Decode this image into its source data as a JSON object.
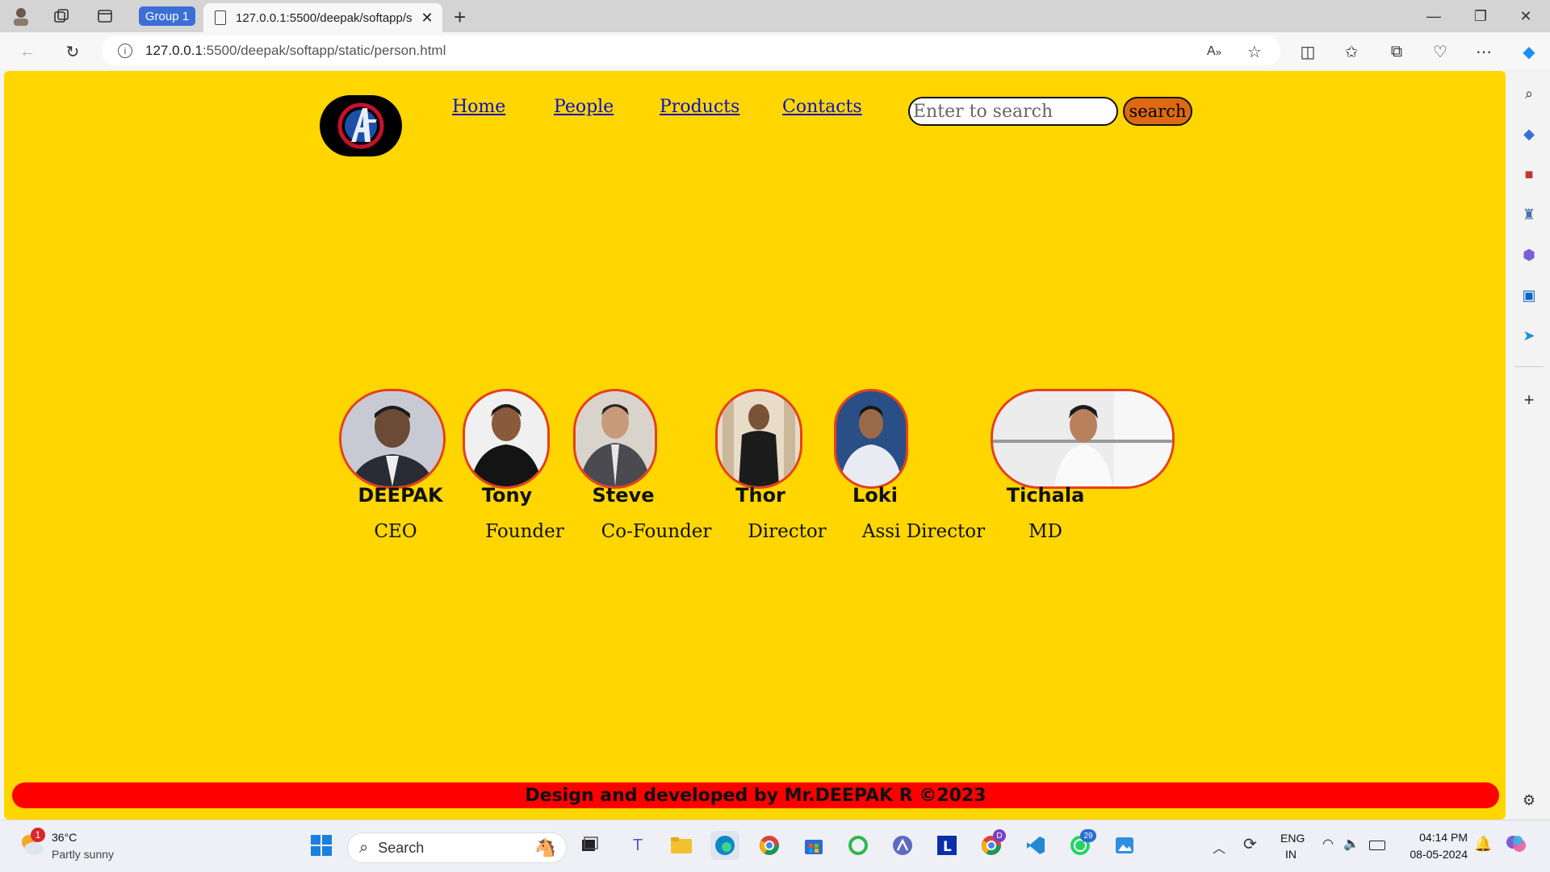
{
  "browser": {
    "group_label": "Group 1",
    "tab_title": "127.0.0.1:5500/deepak/softapp/s",
    "url_host": "127.0.0.1",
    "url_path": ":5500/deepak/softapp/static/person.html"
  },
  "site": {
    "nav": [
      "Home",
      "People",
      "Products",
      "Contacts"
    ],
    "search_placeholder": "Enter to search",
    "search_button": "search",
    "people": [
      {
        "name": "DEEPAK",
        "role": "CEO"
      },
      {
        "name": "Tony",
        "role": "Founder"
      },
      {
        "name": "Steve",
        "role": "Co-Founder"
      },
      {
        "name": "Thor",
        "role": "Director"
      },
      {
        "name": "Loki",
        "role": "Assi Director"
      },
      {
        "name": "Tichala",
        "role": "MD"
      }
    ],
    "footer": "Design and developed by Mr.DEEPAK R ©2023"
  },
  "taskbar": {
    "weather_temp": "36°C",
    "weather_desc": "Partly sunny",
    "weather_badge": "1",
    "search_label": "Search",
    "lang_1": "ENG",
    "lang_2": "IN",
    "time": "04:14 PM",
    "date": "08-05-2024",
    "whatsapp_badge": "29",
    "chrome_badge": "D"
  },
  "colors": {
    "page_bg": "#ffd600",
    "link": "#0b10c8",
    "footer_bg": "#ff0000",
    "photo_border": "#e8401c",
    "search_button_bg": "#dd6a12"
  }
}
